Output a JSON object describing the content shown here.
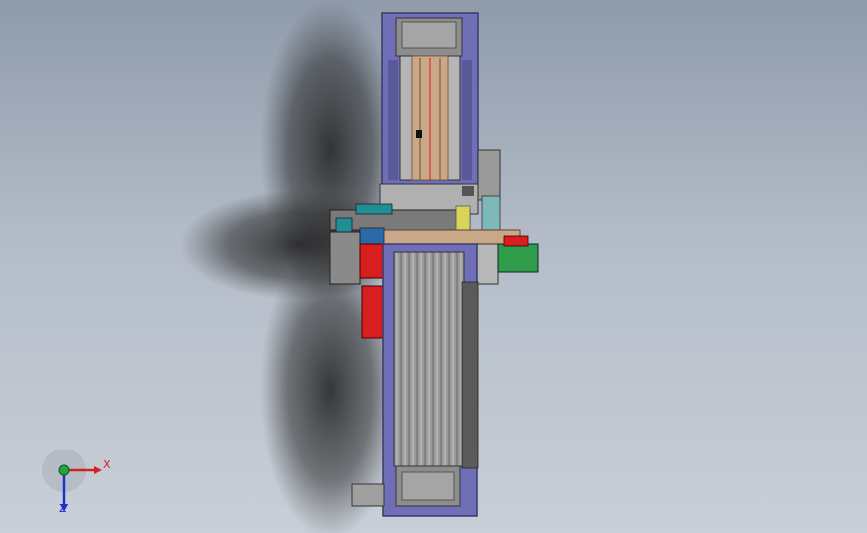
{
  "viewport": {
    "background_top": "#8f9bab",
    "background_bottom": "#c9cfd8"
  },
  "model": {
    "frame_color": "#6f6fb8",
    "frame_dark": "#4a4a8c",
    "body_color": "#a9a9a9",
    "rail_color": "#8d8d8d",
    "gantry_color": "#c9a88a",
    "accent_red": "#d81e1e",
    "accent_green": "#2e9c4a",
    "accent_teal": "#1f8f95",
    "accent_yellow": "#d8d45a"
  },
  "triad": {
    "x_label": "X",
    "z_label": "Z",
    "x_color": "#d62020",
    "y_color": "#1fa53a",
    "z_color": "#2030c8"
  }
}
